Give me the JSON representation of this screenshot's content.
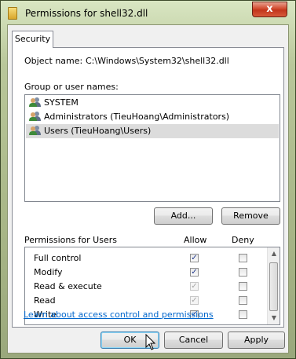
{
  "window": {
    "title": "Permissions for shell32.dll",
    "close_glyph": "x"
  },
  "tab": {
    "label": "Security"
  },
  "object": {
    "label": "Object name:",
    "value": "C:\\Windows\\System32\\shell32.dll"
  },
  "groups": {
    "label": "Group or user names:",
    "items": [
      {
        "name": "SYSTEM",
        "icon": "users-group-icon",
        "selected": false
      },
      {
        "name": "Administrators (TieuHoang\\Administrators)",
        "icon": "users-group-icon",
        "selected": false
      },
      {
        "name": "Users (TieuHoang\\Users)",
        "icon": "users-group-icon",
        "selected": true
      }
    ]
  },
  "buttons": {
    "add": "Add...",
    "remove": "Remove",
    "ok": "OK",
    "cancel": "Cancel",
    "apply": "Apply"
  },
  "permissions": {
    "label": "Permissions for Users",
    "allow_header": "Allow",
    "deny_header": "Deny",
    "rows": [
      {
        "name": "Full control",
        "allow": true,
        "allow_disabled": false,
        "deny": false
      },
      {
        "name": "Modify",
        "allow": true,
        "allow_disabled": false,
        "deny": false
      },
      {
        "name": "Read & execute",
        "allow": true,
        "allow_disabled": true,
        "deny": false
      },
      {
        "name": "Read",
        "allow": true,
        "allow_disabled": true,
        "deny": false
      },
      {
        "name": "Write",
        "allow": true,
        "allow_disabled": false,
        "deny": false
      }
    ]
  },
  "help_link": "Learn about access control and permissions",
  "colors": {
    "link": "#0066cc",
    "close_button": "#c2351c",
    "selection": "#dcdcdc"
  }
}
